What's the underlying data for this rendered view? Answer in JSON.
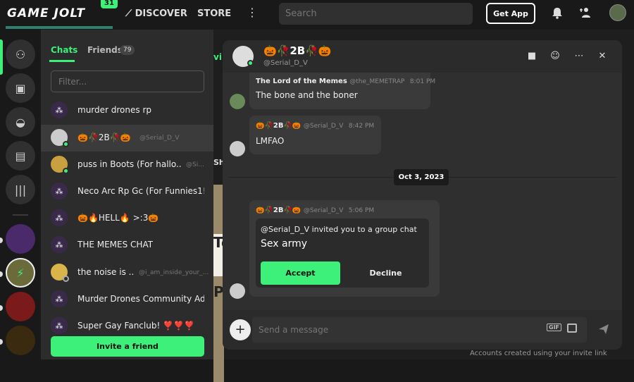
{
  "topbar": {
    "logo": "GAME JOLT",
    "logo_badge": "31",
    "discover": "DISCOVER",
    "store": "STORE",
    "more": "⋮",
    "search_placeholder": "Search",
    "get_app": "Get App"
  },
  "chat_panel": {
    "tab_chats": "Chats",
    "tab_friends": "Friends",
    "friends_count": "79",
    "filter_placeholder": "Filter...",
    "items": [
      {
        "name": "murder drones rp",
        "sub": ""
      },
      {
        "name": "🎃🥀2B🥀🎃",
        "sub": "@Serial_D_V"
      },
      {
        "name": "puss in Boots (For hallo...",
        "sub": "@Si..."
      },
      {
        "name": "Neco Arc Rp Gc (For Funnies1!...",
        "sub": ""
      },
      {
        "name": "🎃🔥HELL🔥 >:3🎃",
        "sub": ""
      },
      {
        "name": "THE MEMES CHAT",
        "sub": ""
      },
      {
        "name": "the noise is ...",
        "sub": "@i_am_inside_your_..."
      },
      {
        "name": "Murder Drones Community Ad...",
        "sub": ""
      },
      {
        "name": "Super Gay Fanclub! ❣️❣️❣️",
        "sub": ""
      }
    ],
    "invite_button": "Invite a friend"
  },
  "backdrop": {
    "fragment_vi": "vi",
    "fragment_sh": "Sh",
    "fragment_to": "To",
    "fragment_p": "P",
    "bottom_text": "Accounts created using your invite link"
  },
  "chat_window": {
    "title": "🎃🥀2B🥀🎃",
    "handle": "@Serial_D_V",
    "messages": [
      {
        "author": "The Lord of the Memes",
        "handle": "@the_MEMETRAP",
        "time": "8:01 PM",
        "text": "The bone and the boner"
      },
      {
        "author": "🎃🥀2B🥀🎃",
        "handle": "@Serial_D_V",
        "time": "8:42 PM",
        "text": "LMFAO"
      }
    ],
    "date_divider": "Oct 3, 2023",
    "invite_message": {
      "author": "🎃🥀2B🥀🎃",
      "handle": "@Serial_D_V",
      "time": "5:06 PM",
      "line1": "@Serial_D_V invited you to a group chat",
      "group_name": "Sex army",
      "accept": "Accept",
      "decline": "Decline"
    },
    "composer_placeholder": "Send a message",
    "gif_label": "GIF"
  },
  "colors": {
    "accent": "#3cf07a",
    "background": "#191919",
    "panel": "#2c2c2c",
    "chat_bg": "#2f2f2f"
  }
}
